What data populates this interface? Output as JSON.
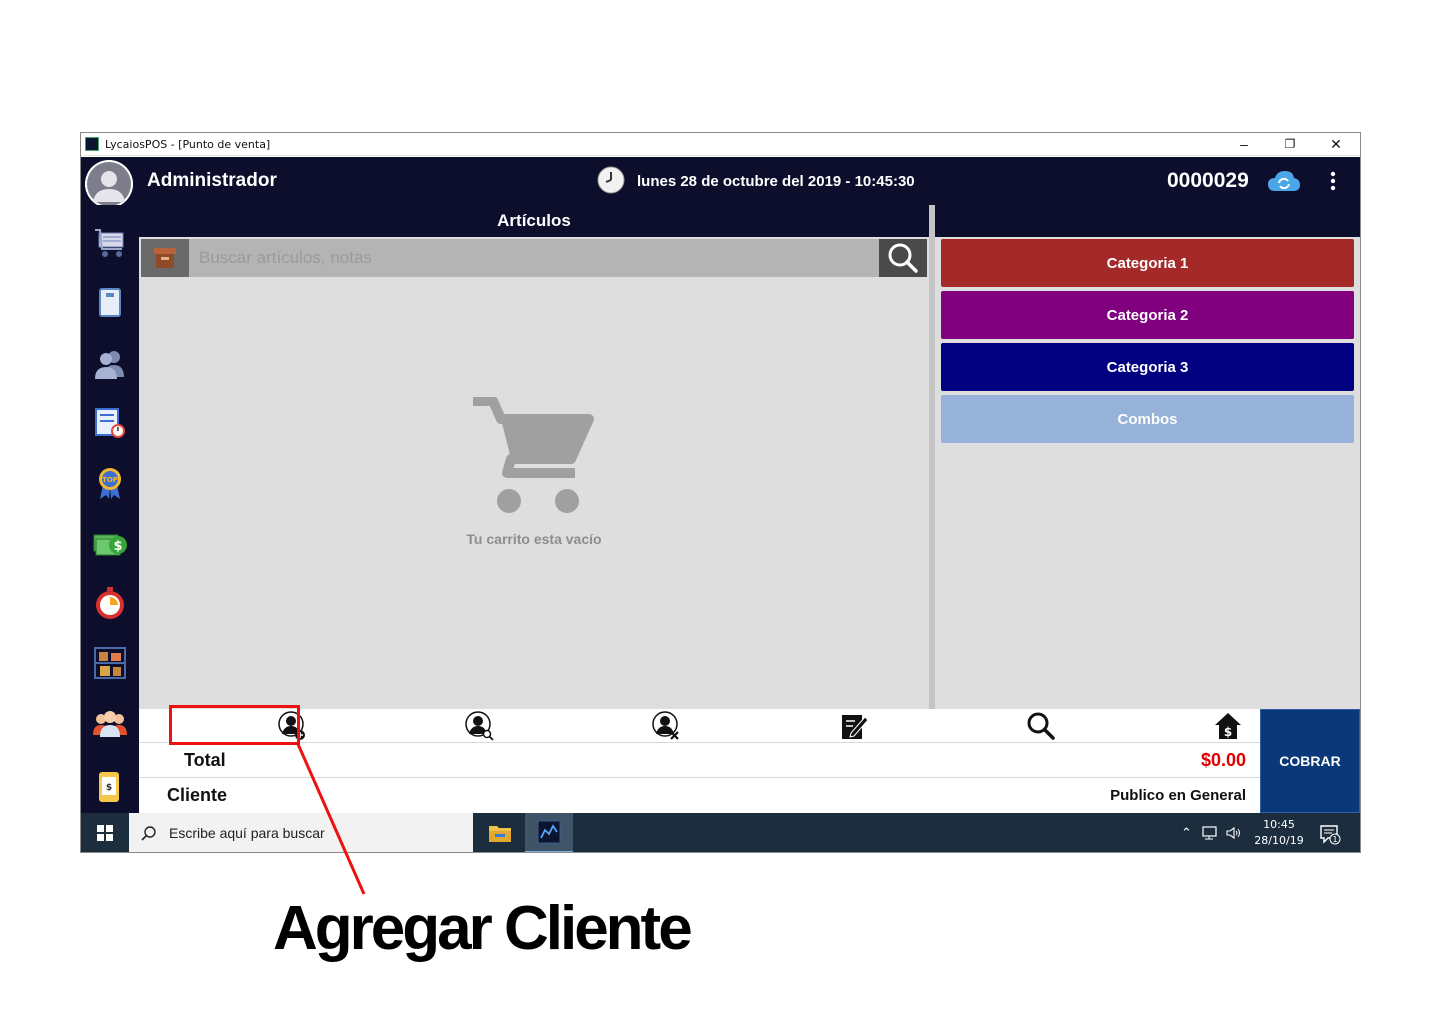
{
  "window": {
    "title": "LycaiosPOS - [Punto de venta]",
    "controls": {
      "minimize": "–",
      "maximize": "❐",
      "close": "✕"
    }
  },
  "header": {
    "user": "Administrador",
    "datetime": "lunes 28 de octubre del 2019 - 10:45:30",
    "folio": "0000029"
  },
  "sidebar": {
    "items": [
      {
        "icon": "shopping-cart-icon"
      },
      {
        "icon": "notebook-icon"
      },
      {
        "icon": "users-icon"
      },
      {
        "icon": "report-clock-icon"
      },
      {
        "icon": "top-badge-icon"
      },
      {
        "icon": "money-icon"
      },
      {
        "icon": "stopwatch-icon"
      },
      {
        "icon": "shelves-icon"
      },
      {
        "icon": "team-icon"
      },
      {
        "icon": "app-icon"
      }
    ]
  },
  "articles": {
    "title": "Artículos",
    "search_placeholder": "Buscar artículos, notas",
    "empty_message": "Tu carrito esta vacío"
  },
  "categories": [
    {
      "label": "Categoria 1",
      "color": "#a42a2a"
    },
    {
      "label": "Categoria 2",
      "color": "#800080"
    },
    {
      "label": "Categoria 3",
      "color": "#000080"
    },
    {
      "label": "Combos",
      "color": "#96b2d8"
    }
  ],
  "actions": [
    {
      "icon": "add-client-icon"
    },
    {
      "icon": "search-client-icon"
    },
    {
      "icon": "remove-client-icon"
    },
    {
      "icon": "notes-icon"
    },
    {
      "icon": "search-icon"
    },
    {
      "icon": "cash-home-icon"
    }
  ],
  "totals": {
    "total_label": "Total",
    "total_value": "$0.00",
    "client_label": "Cliente",
    "client_value": "Publico en General",
    "pay_button": "COBRAR"
  },
  "taskbar": {
    "search_text": "Escribe aquí para buscar",
    "time": "10:45",
    "date": "28/10/19",
    "notification_count": "1"
  },
  "annotation": {
    "label": "Agregar Cliente"
  },
  "colors": {
    "header_bg": "#0c0e2b",
    "panel_bg": "#dedede",
    "total_red": "#e00000",
    "pay_blue": "#0a3879",
    "annotation_red": "#ee1111"
  }
}
